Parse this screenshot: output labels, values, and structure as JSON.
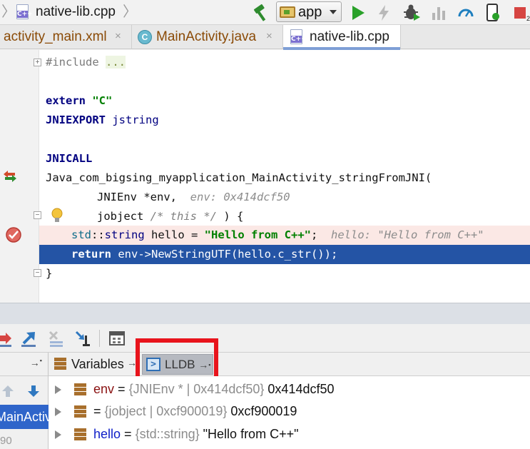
{
  "toolbar": {
    "breadcrumb_file": "native-lib.cpp",
    "file_icon_text": "C++",
    "run_config": "app",
    "notification_count": "2"
  },
  "tabs": [
    {
      "label": "activity_main.xml",
      "close": "×"
    },
    {
      "label": "MainActivity.java",
      "icon": "C",
      "close": "×"
    },
    {
      "label": "native-lib.cpp",
      "icon": "C++",
      "active": true
    }
  ],
  "editor": {
    "line_include": {
      "keyword": "#include",
      "folded": "..."
    },
    "line_extern": {
      "keyword": "extern",
      "string": "\"C\""
    },
    "line_jniexport": {
      "keyword": "JNIEXPORT",
      "type": "jstring"
    },
    "line_jnicall": {
      "keyword": "JNICALL"
    },
    "line_function": {
      "text": "Java_com_bigsing_myapplication_MainActivity_stringFromJNI("
    },
    "line_param1": {
      "code": "JNIEnv *env,",
      "hint": "env: 0x414dcf50"
    },
    "line_param2": {
      "code": "jobject",
      "comment": "/* this */",
      "tail": ") {"
    },
    "line_hello": {
      "ns": "std",
      "sep": "::",
      "type": "string",
      "code": " hello = ",
      "string": "\"Hello from C++\"",
      "end": ";",
      "hint": "hello: \"Hello from C++\""
    },
    "line_return": {
      "keyword": "return",
      "code": " env->NewStringUTF(hello.c_str());"
    },
    "line_close": {
      "text": "}"
    }
  },
  "debugger": {
    "tabs": {
      "variables": "Variables",
      "lldb": "LLDB",
      "pin_arrow": "→",
      "pin_dot": "▪"
    },
    "frame_selected": "MainActivit",
    "frame_next": "90",
    "variables": [
      {
        "name": "env",
        "type": "{JNIEnv * | 0x414dcf50}",
        "value": "0x414dcf50"
      },
      {
        "name": "",
        "type": "{jobject | 0xcf900019}",
        "value": "0xcf900019"
      },
      {
        "name": "hello",
        "type": "{std::string}",
        "value": "\"Hello from C++\""
      }
    ],
    "equals": "="
  },
  "colors": {
    "accent_red": "#e8141c",
    "selection": "#2454a5",
    "run_green": "#2aa12a"
  }
}
